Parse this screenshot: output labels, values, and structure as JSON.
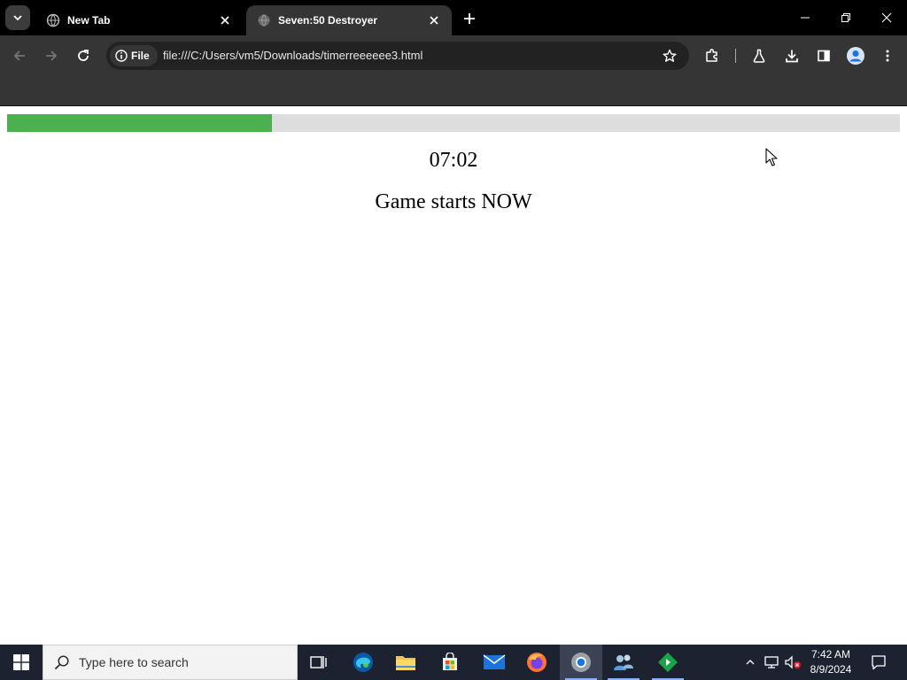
{
  "browser": {
    "tabs": [
      {
        "title": "New Tab",
        "active": false
      },
      {
        "title": "Seven:50 Destroyer",
        "active": true
      }
    ],
    "site_chip_label": "File",
    "url": "file:///C:/Users/vm5/Downloads/timerreeeeee3.html"
  },
  "page": {
    "progress_fraction": 0.297,
    "timer": "07:02",
    "status": "Game starts NOW"
  },
  "taskbar": {
    "search_placeholder": "Type here to search",
    "apps": [
      "task-view",
      "edge",
      "file-explorer",
      "store",
      "mail",
      "firefox",
      "chrome",
      "people",
      "app-green"
    ],
    "clock_time": "7:42 AM",
    "clock_date": "8/9/2024"
  },
  "colors": {
    "progress_fill": "#4caf50",
    "progress_track": "#dddddd",
    "chrome_dark": "#353535",
    "taskbar": "#1c2230"
  }
}
